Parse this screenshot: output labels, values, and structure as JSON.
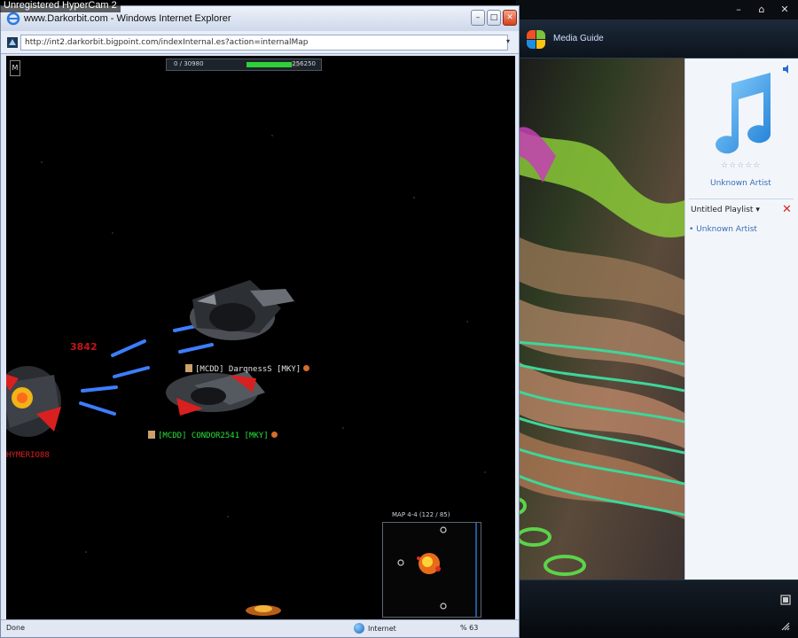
{
  "recorder_banner": "Unregistered HyperCam 2",
  "wmp": {
    "title": "Media Guide",
    "artist_label": "Unknown Artist",
    "rating_stars": "☆☆☆☆☆",
    "playlist_header": "Untitled Playlist",
    "playlist_item": "Unknown Artist",
    "controls": [
      "–",
      "⌂",
      "✕"
    ]
  },
  "ie": {
    "title": "www.Darkorbit.com - Windows Internet Explorer",
    "url": "http://int2.darkorbit.bigpoint.com/indexInternal.es?action=internalMap",
    "buttons": {
      "minimize": "–",
      "maximize": "□",
      "close": "✕"
    },
    "status": {
      "left": "Done",
      "zone": "Internet",
      "zoom": "% 63"
    }
  },
  "game": {
    "menu_icon": "M",
    "hud": {
      "left": "0 / 30980",
      "right": "256250"
    },
    "hp_fraction": 0.85,
    "damage_text": "3842",
    "players": [
      {
        "name": "[MCDD] DarqnessS [MKY]",
        "color": "#e0e0e0"
      },
      {
        "name": "[MCDD] CONDOR2541 [MKY]",
        "color": "#27e33a"
      },
      {
        "name": "HYMERIO88",
        "color": "#d82020"
      }
    ],
    "minimap_label": "MAP 4-4 (122 / 85)"
  },
  "colors": {
    "laser": "#3d7dff",
    "friendly": "#27e33a",
    "enemy": "#d82020",
    "damage": "#c0151a"
  }
}
